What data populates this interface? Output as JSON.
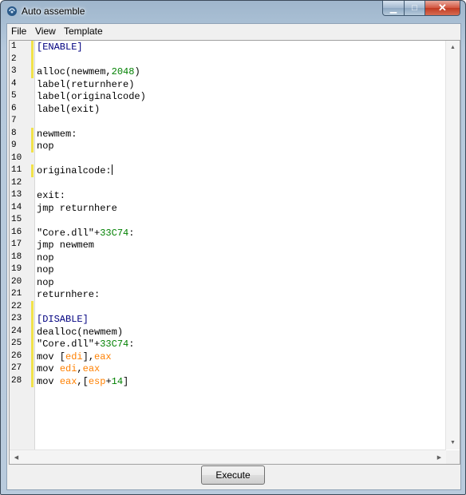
{
  "window": {
    "title": "Auto assemble"
  },
  "menu": [
    "File",
    "View",
    "Template"
  ],
  "editor": {
    "line_numbers": [
      "1",
      "2",
      "3",
      "4",
      "5",
      "6",
      "7",
      "8",
      "9",
      "10",
      "11",
      "12",
      "13",
      "14",
      "15",
      "16",
      "17",
      "18",
      "19",
      "20",
      "21",
      "22",
      "23",
      "24",
      "25",
      "26",
      "27",
      "28"
    ],
    "modified_lines": [
      1,
      2,
      3,
      8,
      9,
      11,
      22,
      23,
      24,
      25,
      26,
      27,
      28
    ],
    "caret_line": 11,
    "lines": [
      [
        {
          "t": "[ENABLE]",
          "c": "k"
        }
      ],
      [],
      [
        {
          "t": "alloc",
          "c": "t"
        },
        {
          "t": "(newmem,",
          "c": "t"
        },
        {
          "t": "2048",
          "c": "n"
        },
        {
          "t": ")",
          "c": "t"
        }
      ],
      [
        {
          "t": "label(returnhere)",
          "c": "t"
        }
      ],
      [
        {
          "t": "label(originalcode)",
          "c": "t"
        }
      ],
      [
        {
          "t": "label(exit)",
          "c": "t"
        }
      ],
      [],
      [
        {
          "t": "newmem:",
          "c": "t"
        }
      ],
      [
        {
          "t": "nop",
          "c": "t"
        }
      ],
      [],
      [
        {
          "t": "originalcode:",
          "c": "t"
        }
      ],
      [],
      [
        {
          "t": "exit:",
          "c": "t"
        }
      ],
      [
        {
          "t": "jmp returnhere",
          "c": "t"
        }
      ],
      [],
      [
        {
          "t": "\"Core.dll\"+",
          "c": "t"
        },
        {
          "t": "33C74",
          "c": "n"
        },
        {
          "t": ":",
          "c": "t"
        }
      ],
      [
        {
          "t": "jmp newmem",
          "c": "t"
        }
      ],
      [
        {
          "t": "nop",
          "c": "t"
        }
      ],
      [
        {
          "t": "nop",
          "c": "t"
        }
      ],
      [
        {
          "t": "nop",
          "c": "t"
        }
      ],
      [
        {
          "t": "returnhere:",
          "c": "t"
        }
      ],
      [],
      [
        {
          "t": "[DISABLE]",
          "c": "k"
        }
      ],
      [
        {
          "t": "dealloc(newmem)",
          "c": "t"
        }
      ],
      [
        {
          "t": "\"Core.dll\"+",
          "c": "t"
        },
        {
          "t": "33C74",
          "c": "n"
        },
        {
          "t": ":",
          "c": "t"
        }
      ],
      [
        {
          "t": "mov [",
          "c": "t"
        },
        {
          "t": "edi",
          "c": "r"
        },
        {
          "t": "],",
          "c": "t"
        },
        {
          "t": "eax",
          "c": "r"
        }
      ],
      [
        {
          "t": "mov ",
          "c": "t"
        },
        {
          "t": "edi",
          "c": "r"
        },
        {
          "t": ",",
          "c": "t"
        },
        {
          "t": "eax",
          "c": "r"
        }
      ],
      [
        {
          "t": "mov ",
          "c": "t"
        },
        {
          "t": "eax",
          "c": "r"
        },
        {
          "t": ",[",
          "c": "t"
        },
        {
          "t": "esp",
          "c": "r"
        },
        {
          "t": "+",
          "c": "t"
        },
        {
          "t": "14",
          "c": "n"
        },
        {
          "t": "]",
          "c": "t"
        }
      ]
    ]
  },
  "buttons": {
    "execute": "Execute"
  },
  "colors": {
    "keyword": "#000080",
    "number": "#008000",
    "register": "#ff8000",
    "modified_marker": "#f1e24a"
  }
}
